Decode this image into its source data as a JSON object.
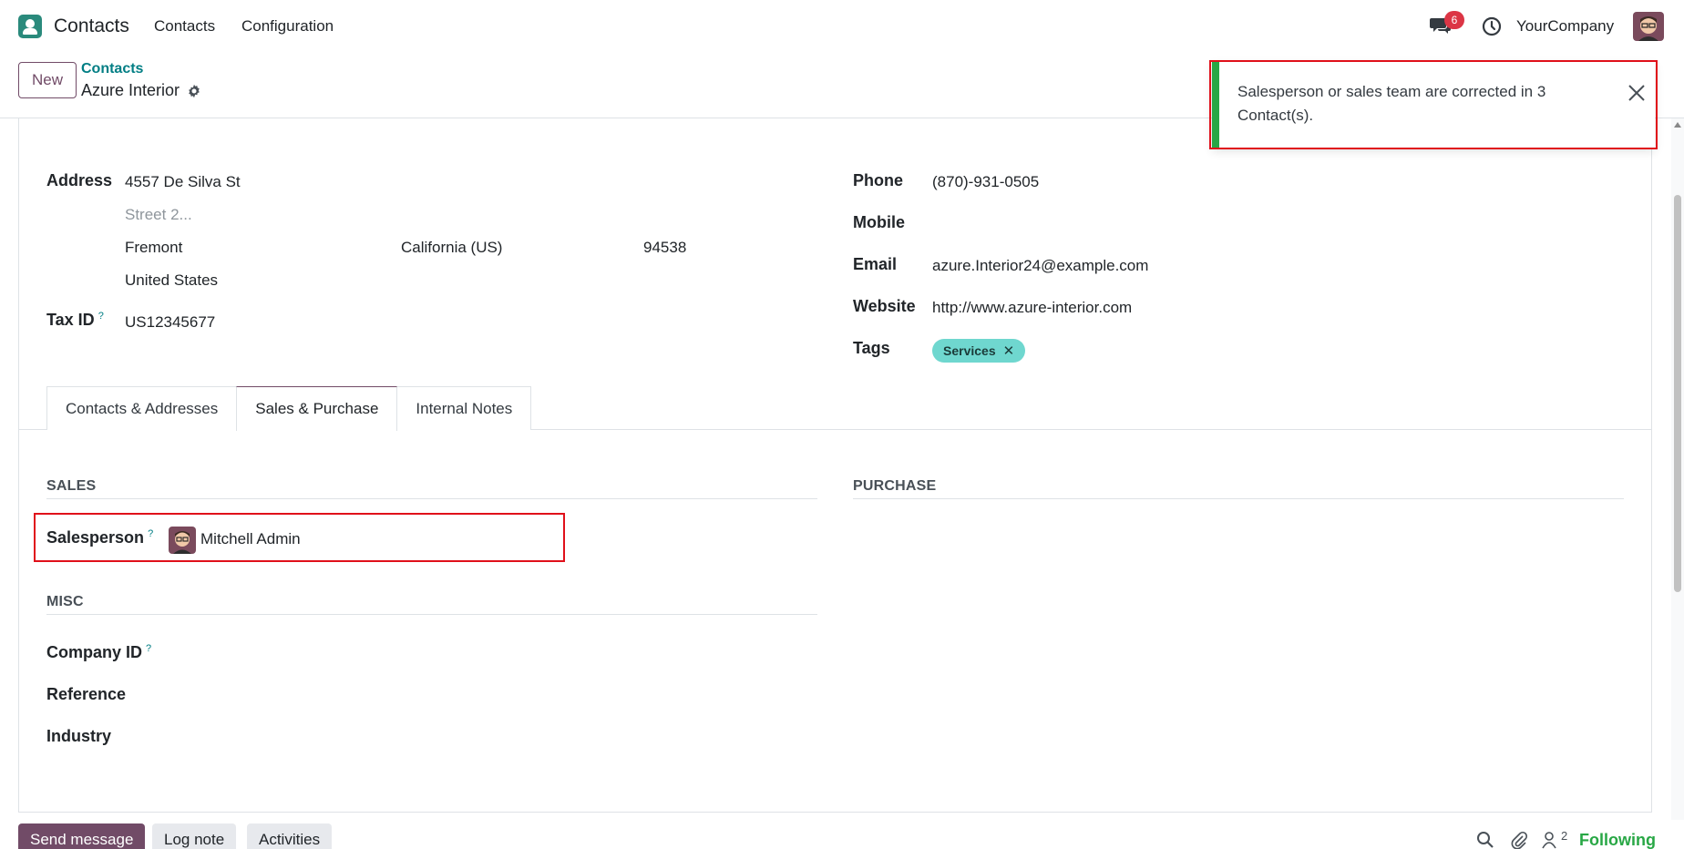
{
  "navbar": {
    "app_name": "Contacts",
    "menus": [
      "Contacts",
      "Configuration"
    ],
    "message_count": "6",
    "company": "YourCompany"
  },
  "control": {
    "new_label": "New",
    "breadcrumb": "Contacts",
    "record_name": "Azure Interior"
  },
  "form": {
    "address_label": "Address",
    "street": "4557 De Silva St",
    "street2_placeholder": "Street 2...",
    "city": "Fremont",
    "state": "California (US)",
    "zip": "94538",
    "country": "United States",
    "tax_id_label": "Tax ID",
    "tax_id": "US12345677",
    "phone_label": "Phone",
    "phone": "(870)-931-0505",
    "mobile_label": "Mobile",
    "email_label": "Email",
    "email": "azure.Interior24@example.com",
    "website_label": "Website",
    "website": "http://www.azure-interior.com",
    "tags_label": "Tags",
    "tags": [
      "Services"
    ]
  },
  "tabs": [
    {
      "label": "Contacts & Addresses"
    },
    {
      "label": "Sales & Purchase",
      "active": true
    },
    {
      "label": "Internal Notes"
    }
  ],
  "sales": {
    "title": "SALES",
    "salesperson_label": "Salesperson",
    "salesperson": "Mitchell Admin"
  },
  "purchase": {
    "title": "PURCHASE"
  },
  "misc": {
    "title": "MISC",
    "company_id_label": "Company ID",
    "reference_label": "Reference",
    "industry_label": "Industry"
  },
  "toast": {
    "message": "Salesperson or sales team are corrected in 3 Contact(s).",
    "accent": "#28a745"
  },
  "chatter": {
    "send_message": "Send message",
    "log_note": "Log note",
    "activities": "Activities",
    "followers_count": "2",
    "following": "Following"
  },
  "colors": {
    "primary": "#714b67",
    "link": "#017e84",
    "highlight": "#e0101a",
    "tag": "#6fd7cf"
  }
}
